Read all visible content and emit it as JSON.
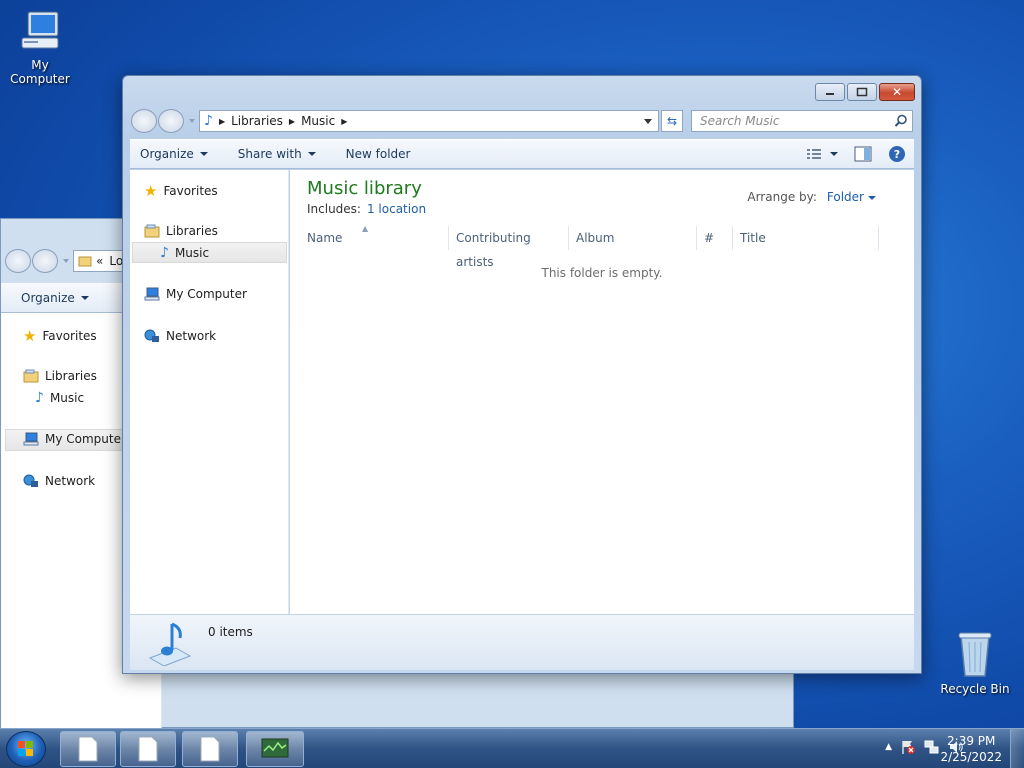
{
  "desktop": {
    "icons": [
      {
        "label": "My Computer",
        "icon": "computer-icon"
      },
      {
        "label": "Recycle Bin",
        "icon": "recycle-bin-icon"
      }
    ]
  },
  "back_window": {
    "address_prefix": "«",
    "address_partial": "Lo",
    "toolbar": {
      "organize": "Organize"
    },
    "nav": {
      "favorites": "Favorites",
      "libraries": "Libraries",
      "music": "Music",
      "my_computer": "My Computer",
      "network": "Network"
    }
  },
  "window": {
    "address": {
      "crumbs": [
        "Libraries",
        "Music"
      ]
    },
    "search_placeholder": "Search Music",
    "toolbar": {
      "organize": "Organize",
      "share_with": "Share with",
      "new_folder": "New folder"
    },
    "nav": {
      "favorites": "Favorites",
      "libraries": "Libraries",
      "music": "Music",
      "my_computer": "My Computer",
      "network": "Network"
    },
    "content": {
      "title": "Music library",
      "includes_label": "Includes:",
      "includes_link": "1 location",
      "arrange_label": "Arrange by:",
      "arrange_value": "Folder",
      "columns": [
        "Name",
        "Contributing artists",
        "Album",
        "#",
        "Title"
      ],
      "empty_message": "This folder is empty."
    },
    "details": {
      "count": "0 items"
    }
  },
  "taskbar": {
    "time": "2:39 PM",
    "date": "2/25/2022",
    "accent": "#2f5384"
  }
}
